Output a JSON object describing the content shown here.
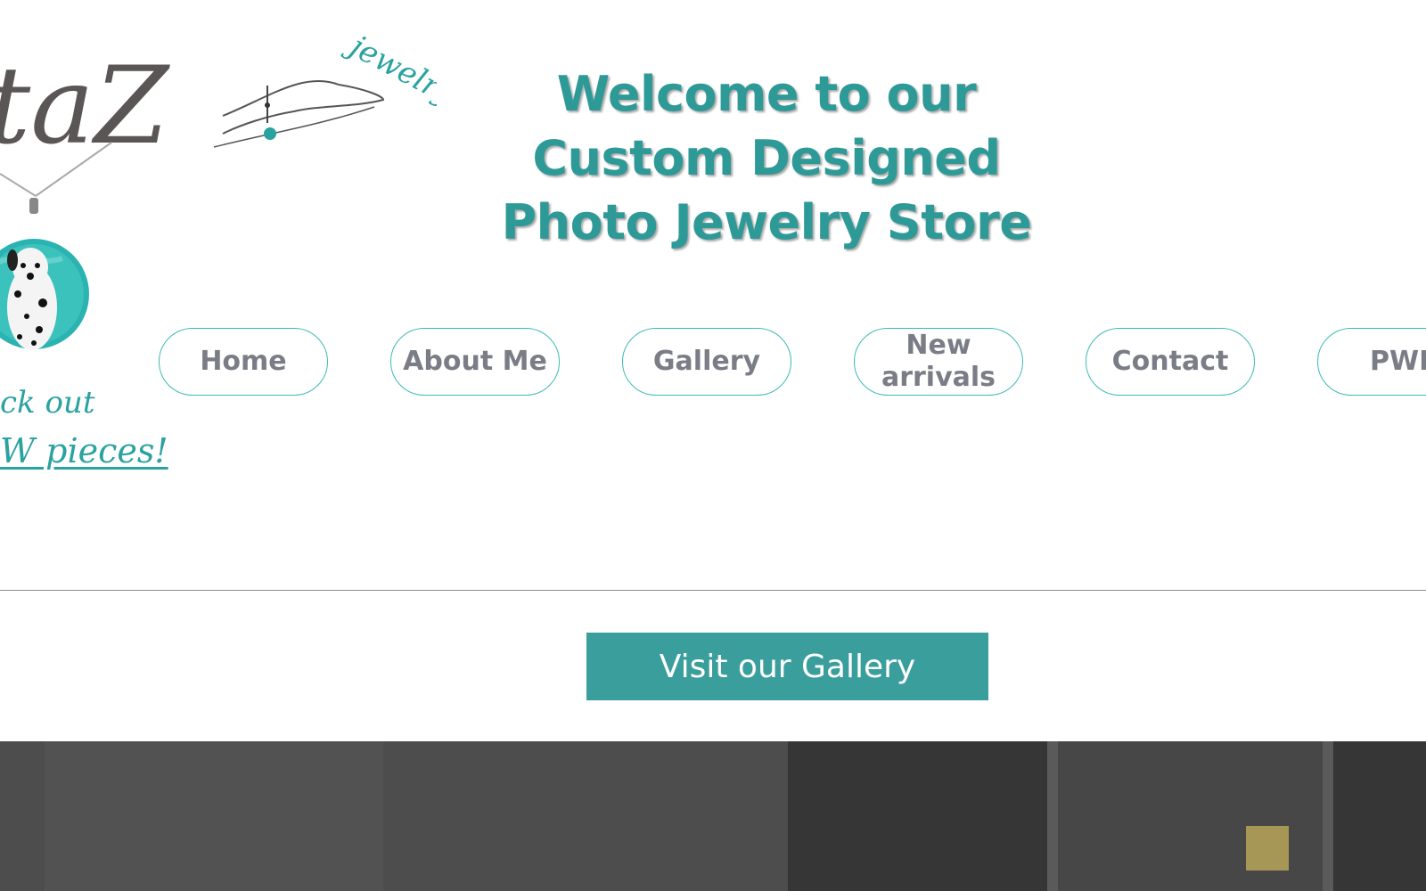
{
  "header": {
    "welcome_lines": [
      "Welcome to our",
      "Custom Designed",
      "Photo Jewelry Store"
    ]
  },
  "logo": {
    "wordmark": "taZ",
    "script": "jewelry",
    "tagline_1": "ck out",
    "tagline_2": "W pieces!"
  },
  "nav": {
    "items": [
      {
        "label": "Home"
      },
      {
        "label": "About Me"
      },
      {
        "label": "Gallery"
      },
      {
        "label": "New arrivals"
      },
      {
        "label": "Contact"
      },
      {
        "label": "PWD"
      }
    ]
  },
  "cta": {
    "label": "Visit our Gallery"
  },
  "colors": {
    "accent": "#2e9a97",
    "button": "#3a9e9c",
    "nav_text": "#7a7d86",
    "logo_gray": "#555555"
  }
}
